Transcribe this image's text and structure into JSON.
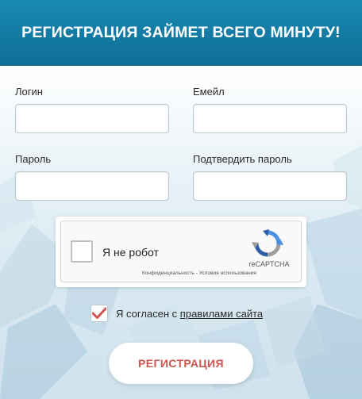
{
  "header": {
    "title": "РЕГИСТРАЦИЯ ЗАЙМЕТ ВСЕГО МИНУТУ!"
  },
  "form": {
    "login_label": "Логин",
    "login_value": "",
    "email_label": "Емейл",
    "email_value": "",
    "password_label": "Пароль",
    "password_value": "",
    "confirm_label": "Подтвердить пароль",
    "confirm_value": ""
  },
  "captcha": {
    "label": "Я не робот",
    "brand": "reCAPTCHA",
    "privacy": "Конфиденциальность",
    "separator": "-",
    "terms": "Условия использования",
    "checked": false
  },
  "agreement": {
    "text": "Я согласен с",
    "link": "правилами сайта",
    "checked": true,
    "check_color": "#d0544f"
  },
  "submit": {
    "label": "РЕГИСТРАЦИЯ"
  },
  "colors": {
    "header": "#137aa3",
    "accent": "#d0544f"
  }
}
